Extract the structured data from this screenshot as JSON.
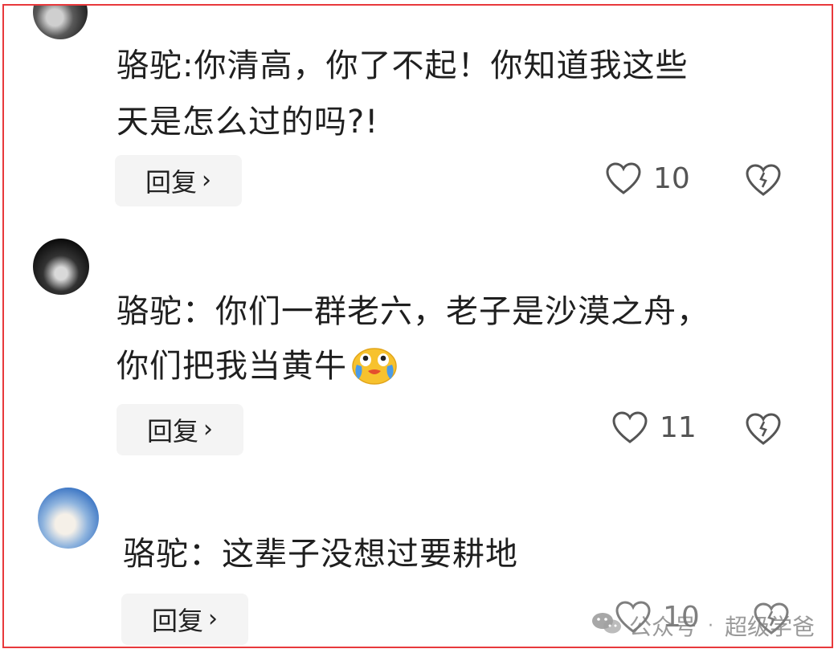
{
  "comments": [
    {
      "line1": "骆驼:你清高，你了不起！你知道我这些",
      "line2": "天是怎么过的吗?!",
      "reply_label": "回复",
      "likes": "10"
    },
    {
      "line1": "骆驼：你们一群老六，老子是沙漠之舟，",
      "line2": "你们把我当黄牛",
      "reply_label": "回复",
      "likes": "11",
      "emoji": "crying-laughing-face"
    },
    {
      "line1": "骆驼：这辈子没想过要耕地",
      "reply_label": "回复",
      "likes": "10"
    }
  ],
  "icons": {
    "like": "heart-outline",
    "dislike": "broken-heart-outline",
    "reply_arrow": "chevron-right"
  },
  "watermark": {
    "left": "公众号",
    "right": "超级学爸"
  },
  "colors": {
    "frame_border": "#e8393c",
    "button_bg": "#f4f4f4",
    "text": "#1f1f1f",
    "icon": "#555555"
  }
}
